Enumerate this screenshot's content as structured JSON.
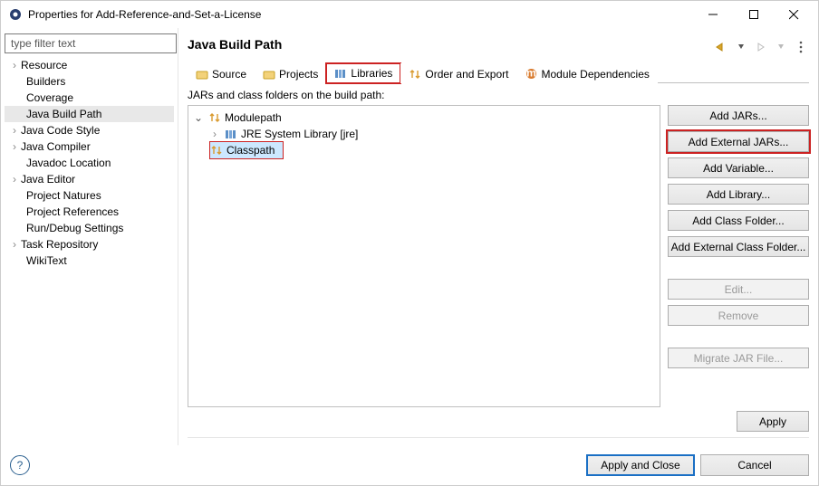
{
  "window": {
    "title": "Properties for Add-Reference-and-Set-a-License"
  },
  "sidebar": {
    "filter_placeholder": "type filter text",
    "items": [
      {
        "label": "Resource",
        "expandable": true
      },
      {
        "label": "Builders"
      },
      {
        "label": "Coverage"
      },
      {
        "label": "Java Build Path",
        "selected": true
      },
      {
        "label": "Java Code Style",
        "expandable": true
      },
      {
        "label": "Java Compiler",
        "expandable": true
      },
      {
        "label": "Javadoc Location"
      },
      {
        "label": "Java Editor",
        "expandable": true
      },
      {
        "label": "Project Natures"
      },
      {
        "label": "Project References"
      },
      {
        "label": "Run/Debug Settings"
      },
      {
        "label": "Task Repository",
        "expandable": true
      },
      {
        "label": "WikiText"
      }
    ]
  },
  "page": {
    "title": "Java Build Path",
    "tabs": [
      "Source",
      "Projects",
      "Libraries",
      "Order and Export",
      "Module Dependencies"
    ],
    "active_tab": 2,
    "subtitle": "JARs and class folders on the build path:",
    "tree": {
      "root": "Modulepath",
      "child1": "JRE System Library [jre]",
      "child2": "Classpath"
    },
    "buttons": {
      "add_jars": "Add JARs...",
      "add_ext_jars": "Add External JARs...",
      "add_var": "Add Variable...",
      "add_lib": "Add Library...",
      "add_cf": "Add Class Folder...",
      "add_ext_cf": "Add External Class Folder...",
      "edit": "Edit...",
      "remove": "Remove",
      "migrate": "Migrate JAR File..."
    },
    "apply": "Apply"
  },
  "footer": {
    "apply_close": "Apply and Close",
    "cancel": "Cancel"
  }
}
